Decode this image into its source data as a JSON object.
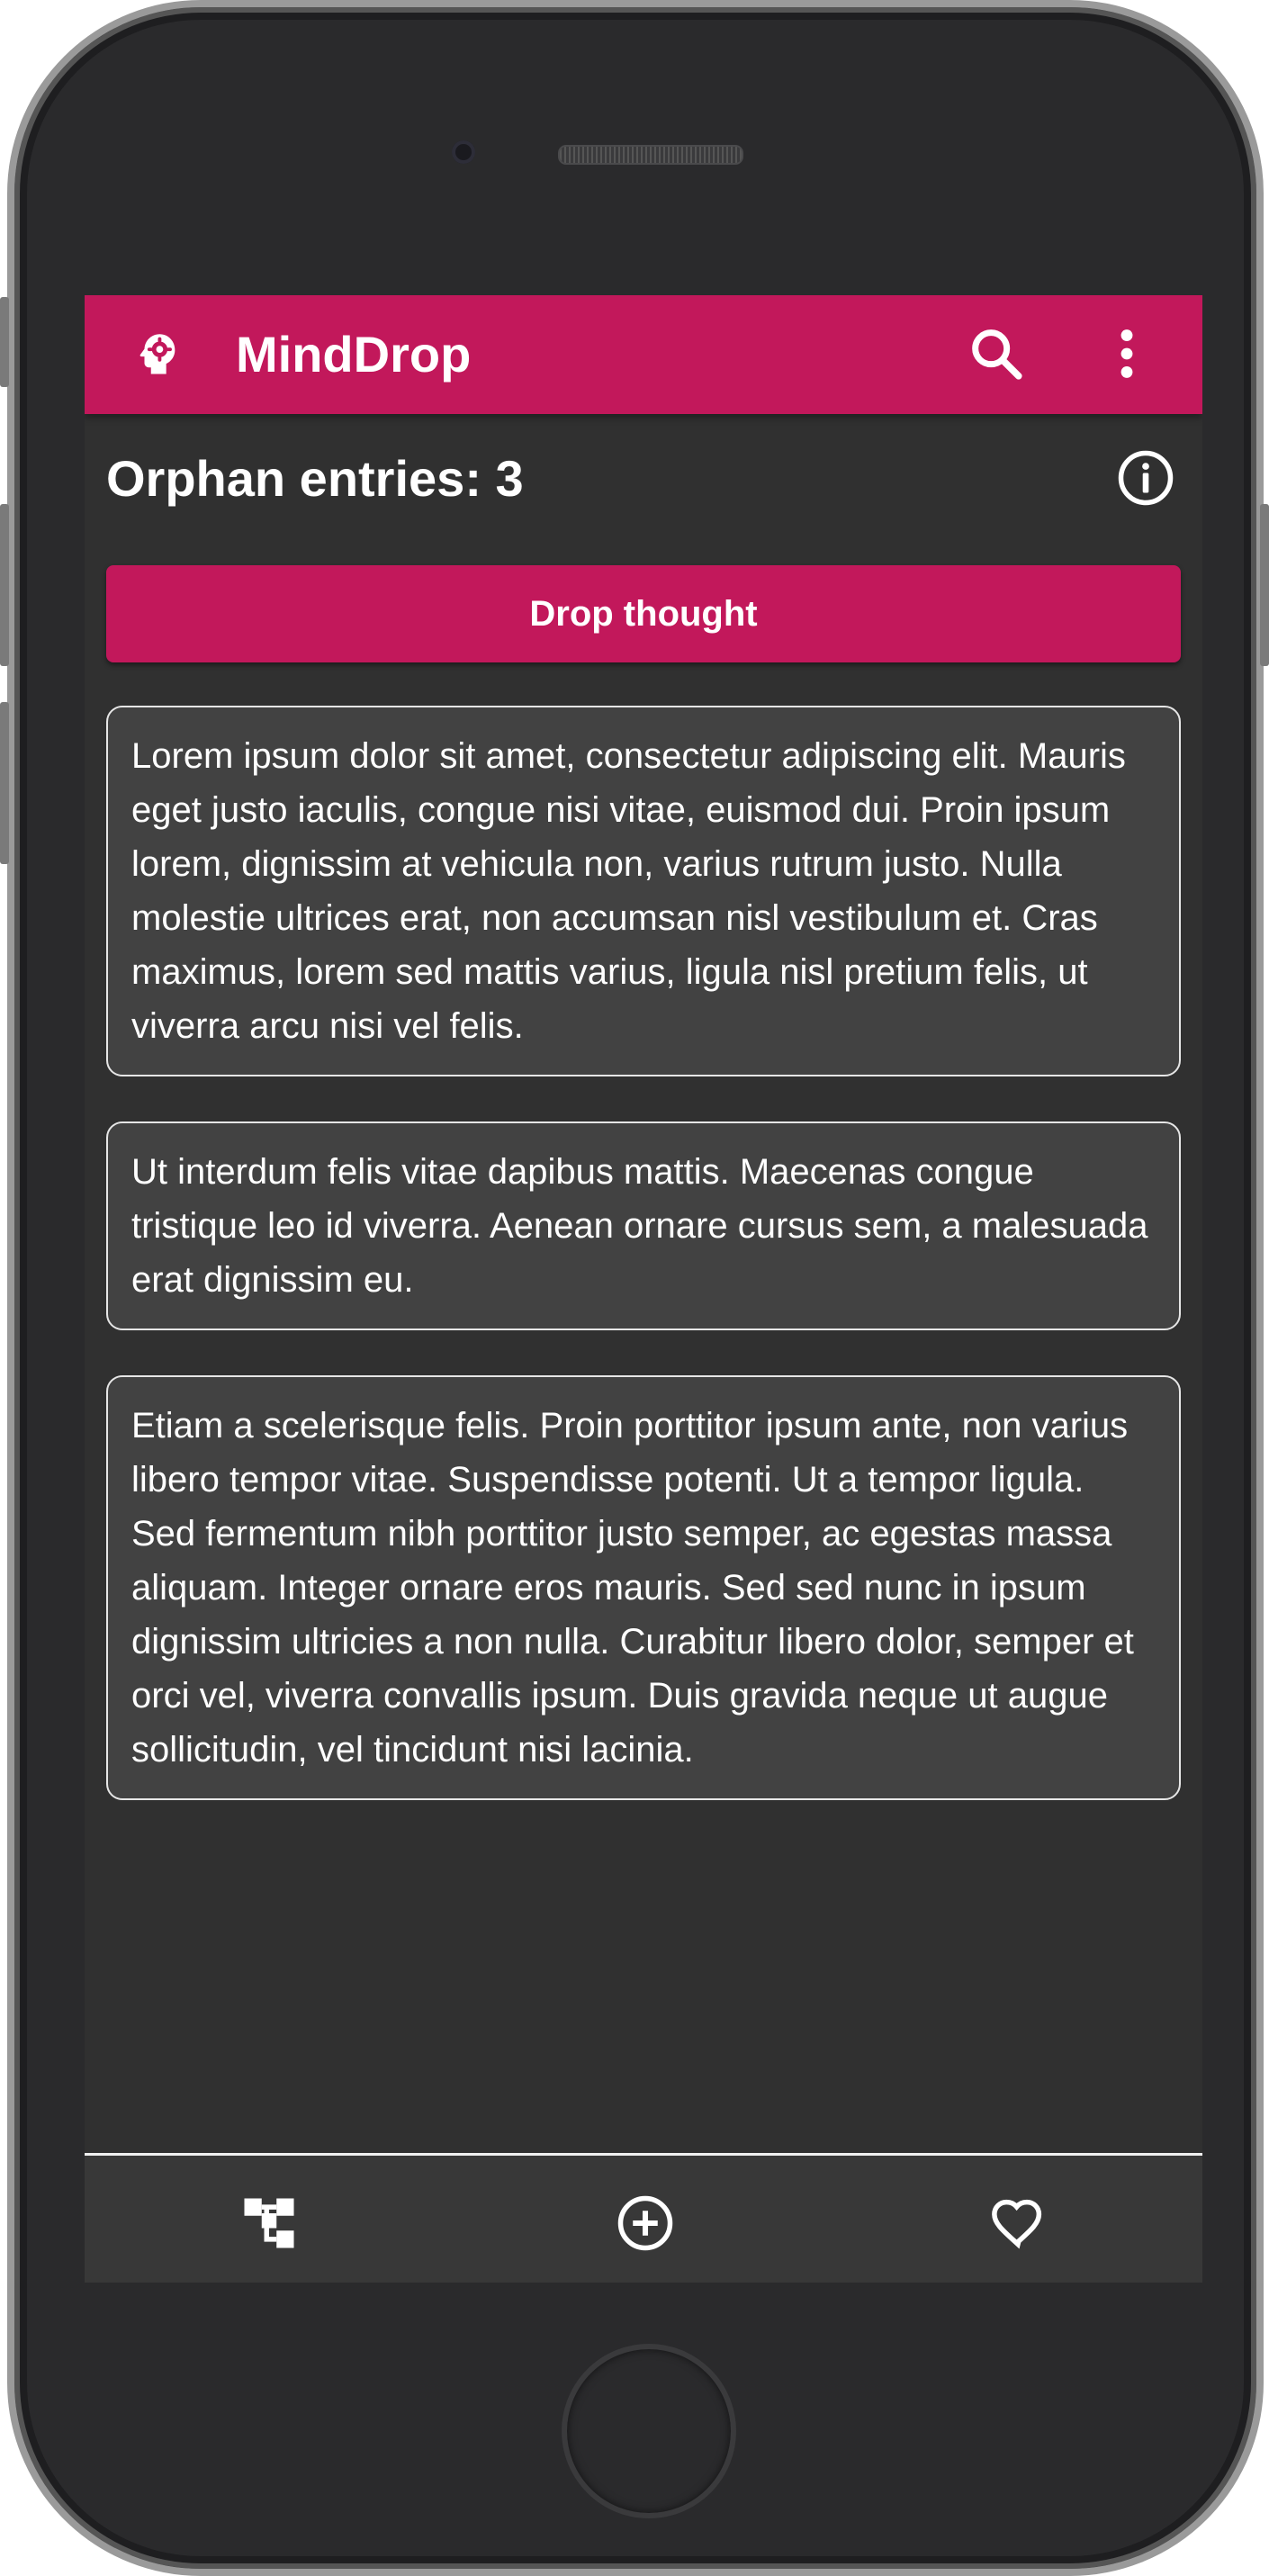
{
  "app": {
    "title": "MindDrop",
    "brand_color": "#c2185b",
    "background_color": "#303030",
    "card_color": "#424242"
  },
  "appbar": {
    "brand_icon": "head-gear-icon",
    "actions": [
      "search-icon",
      "more-vert-icon"
    ]
  },
  "header": {
    "orphan_label": "Orphan entries: 3",
    "info_icon": "info-icon"
  },
  "drop_button": {
    "label": "Drop thought"
  },
  "entries": [
    {
      "text": "Lorem ipsum dolor sit amet, consectetur adipiscing elit. Mauris eget justo iaculis, congue nisi vitae, euismod dui. Proin ipsum lorem, dignissim at vehicula non, varius rutrum justo. Nulla molestie ultrices erat, non accumsan nisl vestibulum et. Cras maximus, lorem sed mattis varius, ligula nisl pretium felis, ut viverra arcu nisi vel felis."
    },
    {
      "text": "Ut interdum felis vitae dapibus mattis. Maecenas congue tristique leo id viverra. Aenean ornare cursus sem, a malesuada erat dignissim eu."
    },
    {
      "text": "Etiam a scelerisque felis. Proin porttitor ipsum ante, non varius libero tempor vitae. Suspendisse potenti. Ut a tempor ligula. Sed fermentum nibh porttitor justo semper, ac egestas massa aliquam. Integer ornare eros mauris. Sed sed nunc in ipsum dignissim ultricies a non nulla. Curabitur libero dolor, semper et orci vel, viverra convallis ipsum. Duis gravida neque ut augue sollicitudin, vel tincidunt nisi lacinia."
    }
  ],
  "bottom_nav": {
    "items": [
      "tree-structure-icon",
      "add-circle-icon",
      "heart-icon"
    ]
  }
}
